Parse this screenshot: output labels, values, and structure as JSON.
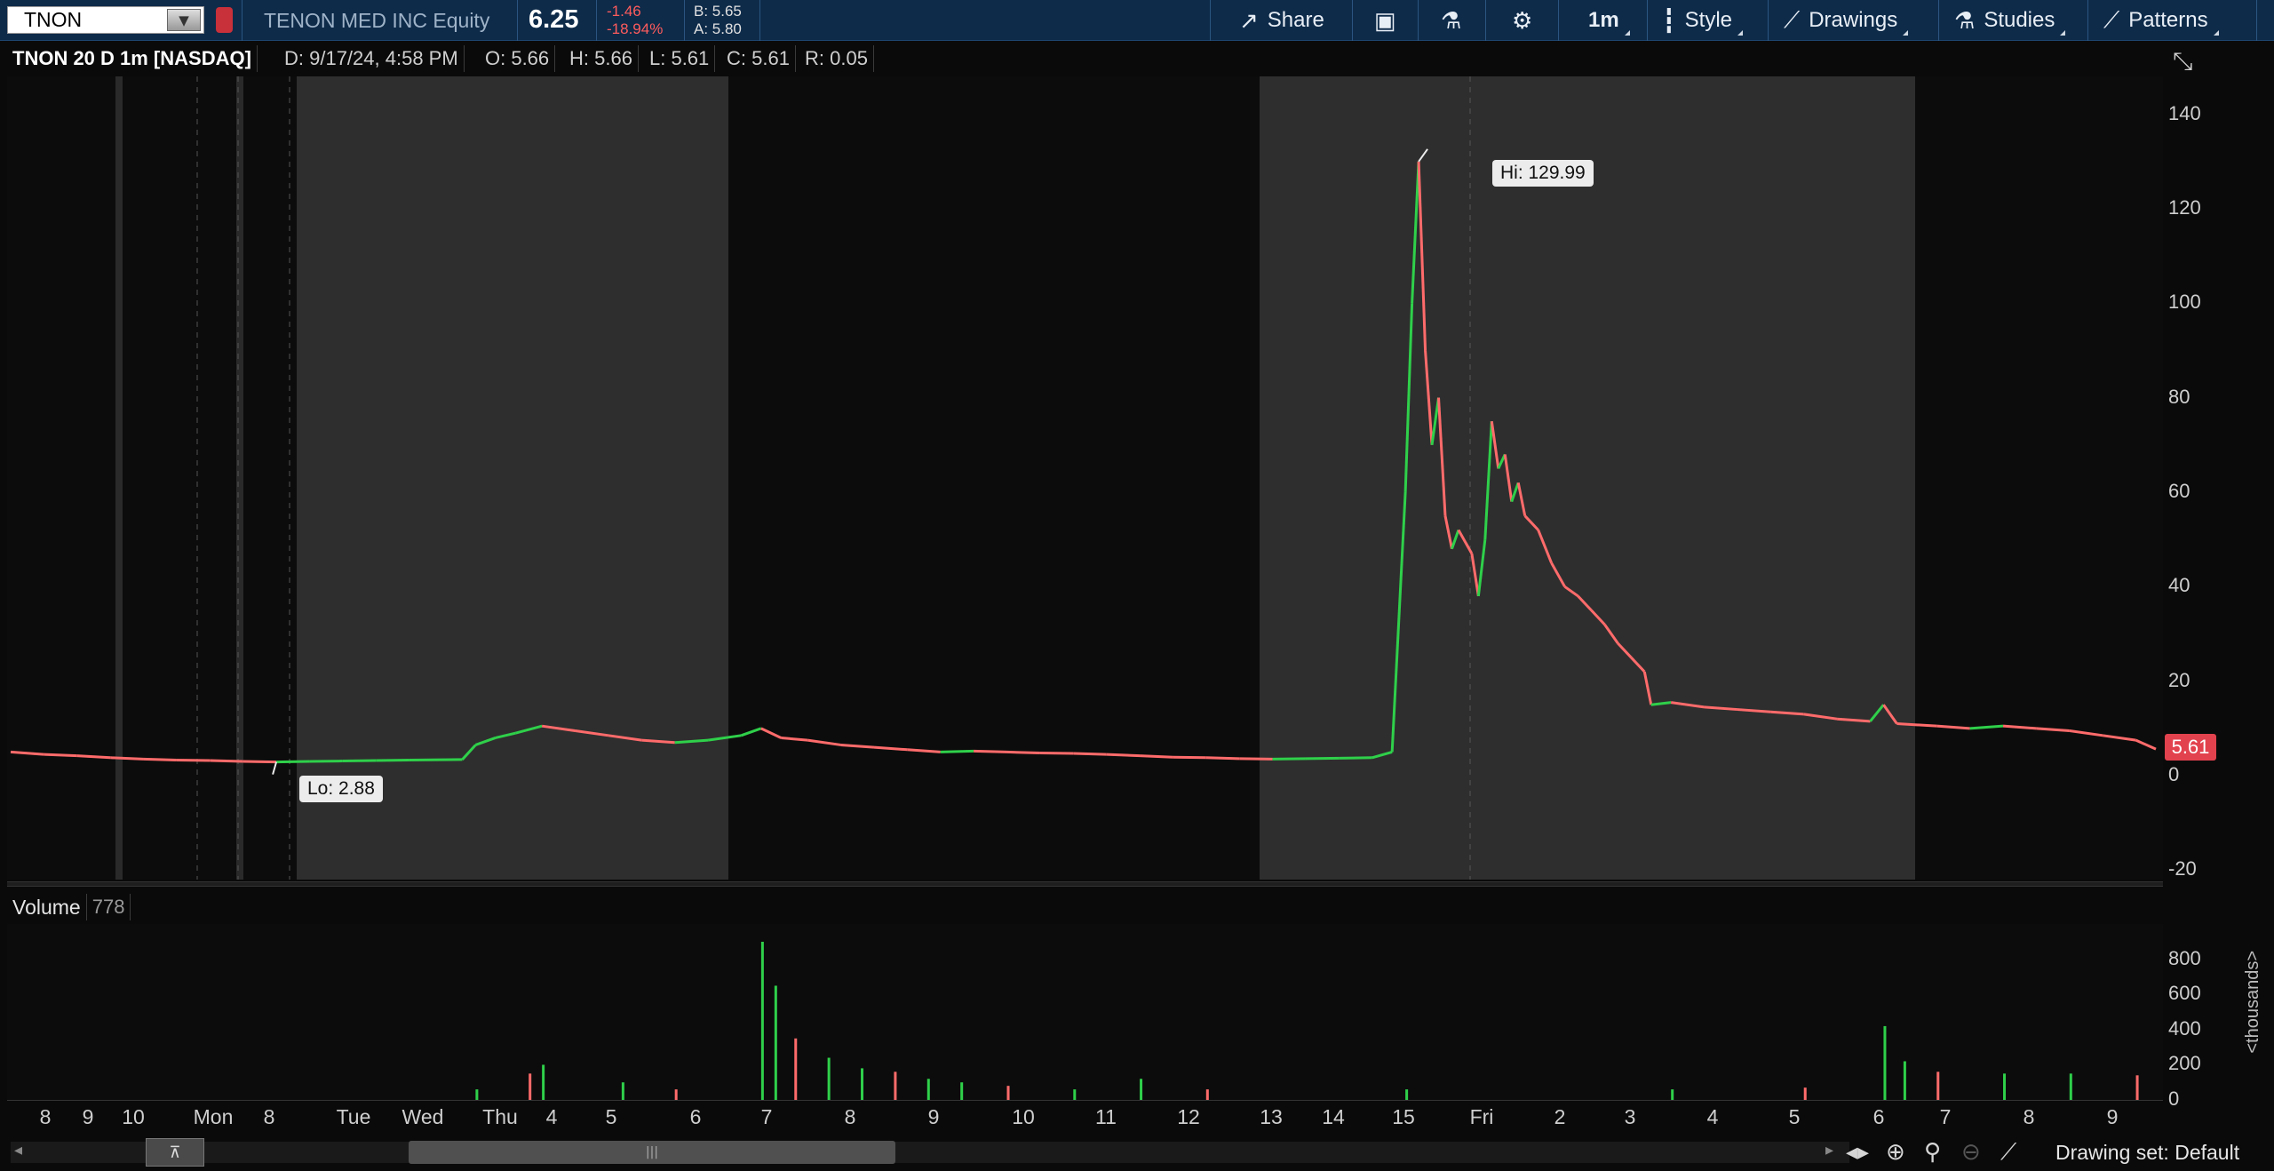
{
  "toolbar": {
    "symbol": "TNON",
    "company": "TENON MED INC Equity",
    "last": "6.25",
    "change": "-1.46",
    "change_pct": "-18.94%",
    "bid": "B: 5.65",
    "ask": "A: 5.80",
    "share_label": "Share",
    "timeframe_label": "1m",
    "style_label": "Style",
    "drawings_label": "Drawings",
    "studies_label": "Studies",
    "patterns_label": "Patterns"
  },
  "infobar": {
    "title": "TNON 20 D 1m [NASDAQ]",
    "date": "D: 9/17/24, 4:58 PM",
    "open": "O: 5.66",
    "high": "H: 5.66",
    "low": "L: 5.61",
    "close": "C: 5.61",
    "range": "R: 0.05"
  },
  "price_axis": {
    "ticks": [
      "140",
      "120",
      "100",
      "80",
      "60",
      "40",
      "20",
      "0",
      "-20"
    ],
    "last_tag": "5.61"
  },
  "callouts": {
    "high": "Hi: 129.99",
    "low": "Lo: 2.88"
  },
  "volume": {
    "label": "Volume",
    "value": "778",
    "ticks": [
      "800",
      "600",
      "400",
      "200",
      "0"
    ],
    "units": "<thousands>"
  },
  "time_axis": {
    "labels": [
      "8",
      "9",
      "10",
      "Mon",
      "8",
      "Tue",
      "Wed",
      "Thu",
      "4",
      "5",
      "6",
      "7",
      "8",
      "9",
      "10",
      "11",
      "12",
      "13",
      "14",
      "15",
      "Fri",
      "2",
      "3",
      "4",
      "5",
      "6",
      "7",
      "8",
      "9"
    ]
  },
  "bottombar": {
    "drawing_set": "Drawing set: Default"
  },
  "colors": {
    "up": "#2fd04a",
    "down": "#ff6b6b",
    "toolbar_bg": "#0e2b4a",
    "last_tag": "#e2424e"
  },
  "chart_data": {
    "type": "line",
    "title": "TNON 20 D 1m [NASDAQ]",
    "y_ticks": [
      140,
      120,
      100,
      80,
      60,
      40,
      20,
      0,
      -20
    ],
    "ylim": [
      -22,
      148
    ],
    "high": 129.99,
    "low": 2.88,
    "last": 5.61,
    "x_labels": [
      "8",
      "9",
      "10",
      "Mon",
      "8",
      "Tue",
      "Wed",
      "Thu",
      "4",
      "5",
      "6",
      "7",
      "8",
      "9",
      "10",
      "11",
      "12",
      "13",
      "14",
      "15",
      "Fri",
      "2",
      "3",
      "4",
      "5",
      "6",
      "7",
      "8",
      "9"
    ],
    "price_series": [
      [
        0,
        5.0
      ],
      [
        0.5,
        4.5
      ],
      [
        1,
        4.2
      ],
      [
        1.5,
        3.8
      ],
      [
        2,
        3.5
      ],
      [
        2.5,
        3.3
      ],
      [
        3,
        3.2
      ],
      [
        3.5,
        3.0
      ],
      [
        4,
        2.9
      ],
      [
        4.5,
        3.0
      ],
      [
        5,
        3.1
      ],
      [
        5.5,
        3.2
      ],
      [
        6,
        3.3
      ],
      [
        6.8,
        3.4
      ],
      [
        7,
        6.5
      ],
      [
        7.3,
        8.0
      ],
      [
        7.6,
        9.0
      ],
      [
        8,
        10.5
      ],
      [
        8.5,
        9.5
      ],
      [
        9,
        8.5
      ],
      [
        9.5,
        7.5
      ],
      [
        10,
        7.0
      ],
      [
        10.5,
        7.5
      ],
      [
        11,
        8.5
      ],
      [
        11.3,
        10.0
      ],
      [
        11.6,
        8.0
      ],
      [
        12,
        7.5
      ],
      [
        12.5,
        6.5
      ],
      [
        13,
        6.0
      ],
      [
        13.5,
        5.5
      ],
      [
        14,
        5.0
      ],
      [
        14.5,
        5.2
      ],
      [
        15,
        5.0
      ],
      [
        15.5,
        4.8
      ],
      [
        16,
        4.7
      ],
      [
        16.5,
        4.5
      ],
      [
        17,
        4.2
      ],
      [
        17.5,
        3.9
      ],
      [
        18,
        3.8
      ],
      [
        18.5,
        3.6
      ],
      [
        19,
        3.5
      ],
      [
        19.5,
        3.6
      ],
      [
        20,
        3.7
      ],
      [
        20.5,
        3.8
      ],
      [
        20.8,
        5.0
      ],
      [
        21.0,
        60.0
      ],
      [
        21.1,
        100.0
      ],
      [
        21.2,
        129.99
      ],
      [
        21.3,
        90.0
      ],
      [
        21.4,
        70.0
      ],
      [
        21.5,
        80.0
      ],
      [
        21.6,
        55.0
      ],
      [
        21.7,
        48.0
      ],
      [
        21.8,
        52.0
      ],
      [
        22.0,
        47.0
      ],
      [
        22.1,
        38.0
      ],
      [
        22.2,
        50.0
      ],
      [
        22.3,
        75.0
      ],
      [
        22.4,
        65.0
      ],
      [
        22.5,
        68.0
      ],
      [
        22.6,
        58.0
      ],
      [
        22.7,
        62.0
      ],
      [
        22.8,
        55.0
      ],
      [
        23.0,
        52.0
      ],
      [
        23.2,
        45.0
      ],
      [
        23.4,
        40.0
      ],
      [
        23.6,
        38.0
      ],
      [
        23.8,
        35.0
      ],
      [
        24.0,
        32.0
      ],
      [
        24.2,
        28.0
      ],
      [
        24.4,
        25.0
      ],
      [
        24.6,
        22.0
      ],
      [
        24.7,
        15.0
      ],
      [
        25.0,
        15.5
      ],
      [
        25.5,
        14.5
      ],
      [
        26.0,
        14.0
      ],
      [
        26.5,
        13.5
      ],
      [
        27.0,
        13.0
      ],
      [
        27.5,
        12.0
      ],
      [
        28.0,
        11.5
      ],
      [
        28.2,
        15.0
      ],
      [
        28.4,
        11.0
      ],
      [
        29.0,
        10.5
      ],
      [
        29.5,
        10.0
      ],
      [
        30.0,
        10.5
      ],
      [
        30.5,
        10.0
      ],
      [
        31.0,
        9.5
      ],
      [
        31.5,
        8.5
      ],
      [
        32.0,
        7.5
      ],
      [
        32.3,
        5.61
      ]
    ],
    "volume_ylim": [
      0,
      900
    ],
    "volume_spikes": [
      [
        7.0,
        60
      ],
      [
        7.8,
        150
      ],
      [
        8.0,
        200
      ],
      [
        9.2,
        100
      ],
      [
        10.0,
        60
      ],
      [
        11.3,
        900
      ],
      [
        11.5,
        650
      ],
      [
        11.8,
        350
      ],
      [
        12.3,
        240
      ],
      [
        12.8,
        180
      ],
      [
        13.3,
        160
      ],
      [
        13.8,
        120
      ],
      [
        14.3,
        100
      ],
      [
        15.0,
        80
      ],
      [
        16.0,
        60
      ],
      [
        17.0,
        120
      ],
      [
        18.0,
        60
      ],
      [
        21.0,
        60
      ],
      [
        25.0,
        60
      ],
      [
        27.0,
        70
      ],
      [
        28.2,
        420
      ],
      [
        28.5,
        220
      ],
      [
        29.0,
        160
      ],
      [
        30.0,
        150
      ],
      [
        31.0,
        150
      ],
      [
        32.0,
        140
      ]
    ]
  }
}
